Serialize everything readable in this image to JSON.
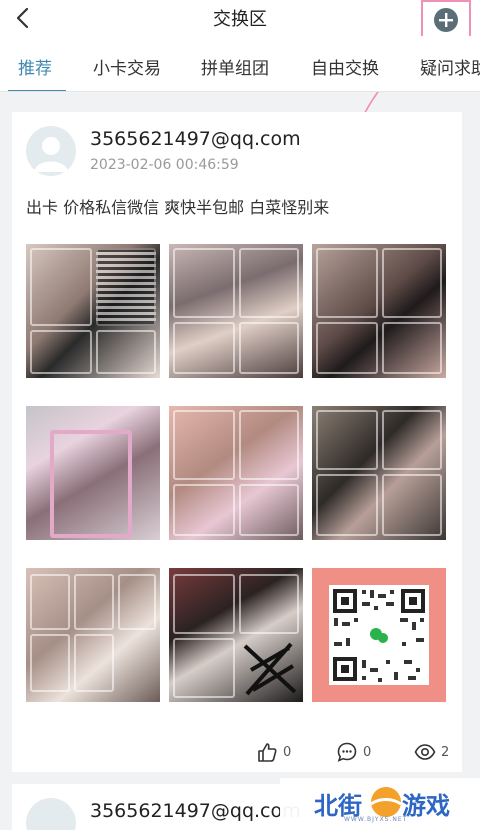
{
  "header": {
    "title": "交换区",
    "back_icon": "chevron-left-icon",
    "add_icon": "plus-circle-icon"
  },
  "tabs": [
    {
      "label": "推荐",
      "active": true
    },
    {
      "label": "小卡交易"
    },
    {
      "label": "拼单组团"
    },
    {
      "label": "自由交换"
    },
    {
      "label": "疑问求助"
    }
  ],
  "post": {
    "user": "3565621497@qq.com",
    "time": "2023-02-06 00:46:59",
    "text": "出卡 价格私信微信 爽快半包邮 白菜怪别来",
    "likes": "0",
    "comments": "0",
    "views": "2"
  },
  "post2": {
    "user": "3565621497@qq.com"
  },
  "watermark": {
    "text_left": "北街",
    "text_right": "游戏",
    "sub": "WWW.BJYXS.NET"
  },
  "colors": {
    "accent": "#3f8ab0",
    "highlight_box": "#f08fb8"
  }
}
